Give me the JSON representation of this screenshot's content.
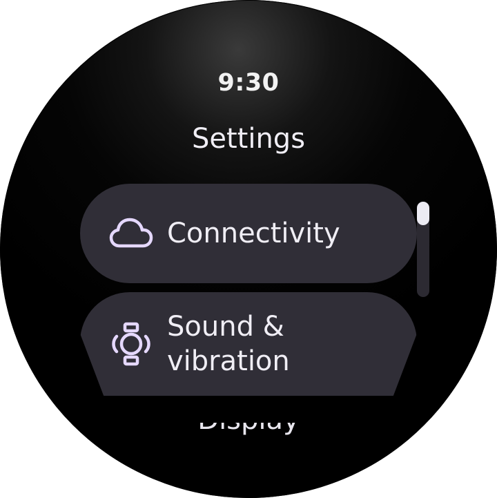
{
  "status": {
    "time": "9:30"
  },
  "header": {
    "title": "Settings"
  },
  "list": {
    "items": [
      {
        "label": "Connectivity",
        "icon": "cloud-icon"
      },
      {
        "label_line1": "Sound &",
        "label_line2": "vibration",
        "icon": "watch-vibrate-icon"
      }
    ],
    "peek_label": "Display"
  },
  "colors": {
    "background": "#000000",
    "chip": "#302e37",
    "accent_icon": "#e5d8ff",
    "text": "#f0eef5",
    "scroll_thumb": "#ecebf3",
    "scroll_track": "#2c2a32"
  }
}
